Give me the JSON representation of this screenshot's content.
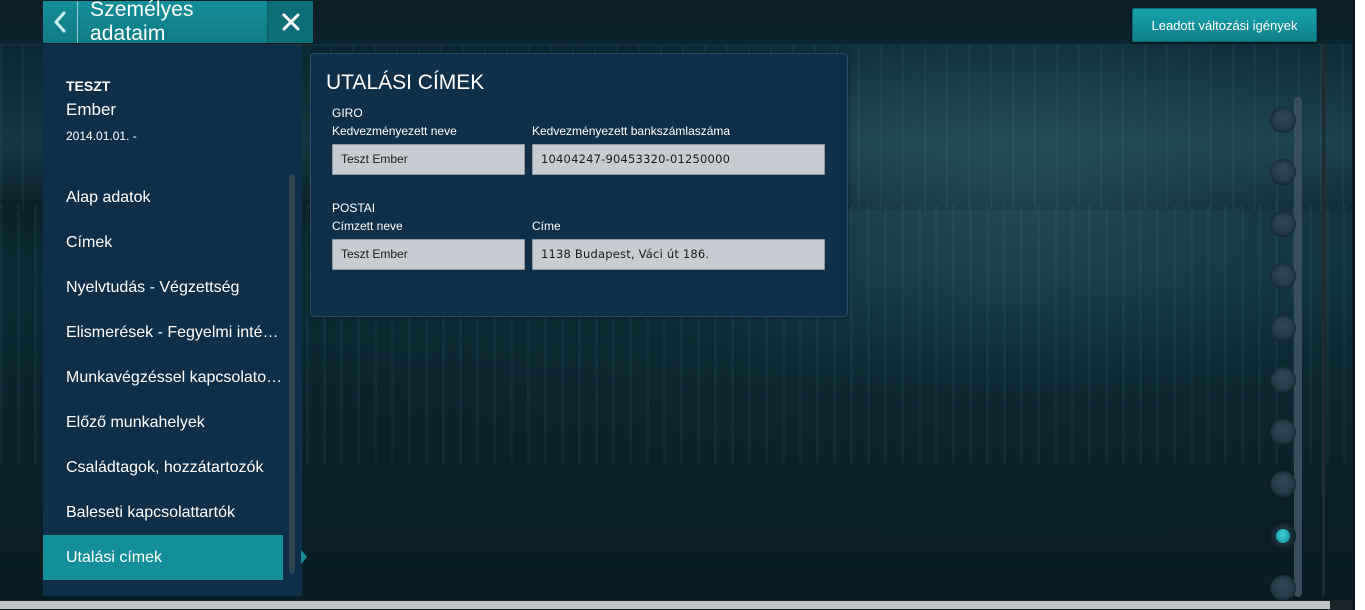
{
  "header": {
    "title": "Személyes adataim",
    "requests_button": "Leadott változási igények"
  },
  "user": {
    "last_name": "TESZT",
    "first_name": "Ember",
    "date": "2014.01.01. -"
  },
  "nav": {
    "items": [
      {
        "label": "Alap adatok"
      },
      {
        "label": "Címek"
      },
      {
        "label": "Nyelvtudás - Végzettség"
      },
      {
        "label": "Elismerések - Fegyelmi intézke."
      },
      {
        "label": "Munkavégzéssel kapcsolatos ..."
      },
      {
        "label": "Előző munkahelyek"
      },
      {
        "label": "Családtagok, hozzátartozók"
      },
      {
        "label": "Baleseti kapcsolattartók"
      },
      {
        "label": "Utalási címek"
      }
    ],
    "active_index": 8
  },
  "card": {
    "title": "UTALÁSI CÍMEK",
    "giro": {
      "section": "GIRO",
      "name_label": "Kedvezményezett  neve",
      "name_value": "Teszt Ember",
      "account_label": "Kedvezményezett bankszámlaszáma",
      "account_value": "10404247-90453320-01250000"
    },
    "postai": {
      "section": "POSTAI",
      "name_label": "Címzett neve",
      "name_value": "Teszt Ember",
      "address_label": "Címe",
      "address_value": "1138 Budapest, Váci út 186."
    }
  },
  "page_indicator": {
    "count": 10,
    "active_index": 8
  },
  "colors": {
    "accent": "#138f99",
    "sidebar": "#0f2f48",
    "card": "#10304a",
    "input": "#c6ccd1"
  }
}
